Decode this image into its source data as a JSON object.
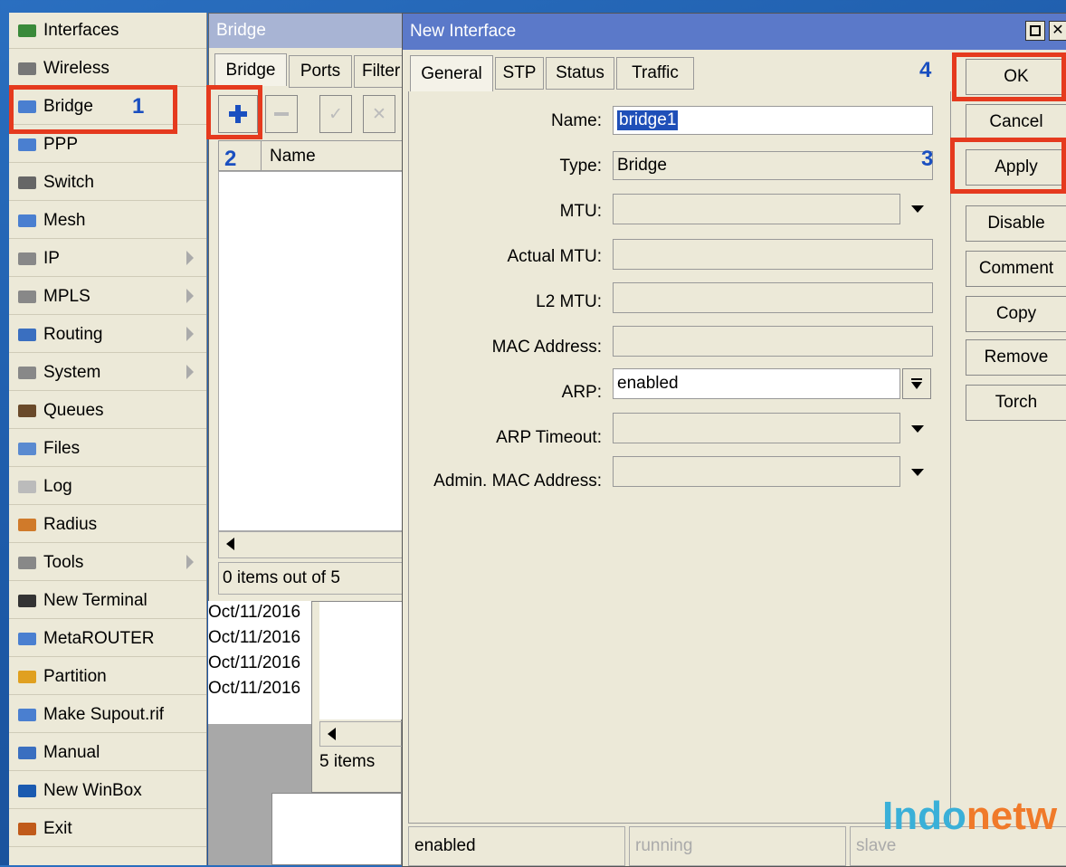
{
  "menu": {
    "items": [
      {
        "label": "Interfaces",
        "icon": "interfaces-icon",
        "sub": false
      },
      {
        "label": "Wireless",
        "icon": "wireless-icon",
        "sub": false
      },
      {
        "label": "Bridge",
        "icon": "bridge-icon",
        "sub": false
      },
      {
        "label": "PPP",
        "icon": "ppp-icon",
        "sub": false
      },
      {
        "label": "Switch",
        "icon": "switch-icon",
        "sub": false
      },
      {
        "label": "Mesh",
        "icon": "mesh-icon",
        "sub": false
      },
      {
        "label": "IP",
        "icon": "ip-icon",
        "sub": true
      },
      {
        "label": "MPLS",
        "icon": "mpls-icon",
        "sub": true
      },
      {
        "label": "Routing",
        "icon": "routing-icon",
        "sub": true
      },
      {
        "label": "System",
        "icon": "system-icon",
        "sub": true
      },
      {
        "label": "Queues",
        "icon": "queues-icon",
        "sub": false
      },
      {
        "label": "Files",
        "icon": "files-icon",
        "sub": false
      },
      {
        "label": "Log",
        "icon": "log-icon",
        "sub": false
      },
      {
        "label": "Radius",
        "icon": "radius-icon",
        "sub": false
      },
      {
        "label": "Tools",
        "icon": "tools-icon",
        "sub": true
      },
      {
        "label": "New Terminal",
        "icon": "terminal-icon",
        "sub": false
      },
      {
        "label": "MetaROUTER",
        "icon": "metarouter-icon",
        "sub": false
      },
      {
        "label": "Partition",
        "icon": "partition-icon",
        "sub": false
      },
      {
        "label": "Make Supout.rif",
        "icon": "supout-icon",
        "sub": false
      },
      {
        "label": "Manual",
        "icon": "manual-icon",
        "sub": false
      },
      {
        "label": "New WinBox",
        "icon": "winbox-icon",
        "sub": false
      },
      {
        "label": "Exit",
        "icon": "exit-icon",
        "sub": false
      }
    ]
  },
  "annotations": {
    "n1": "1",
    "n2": "2",
    "n3": "3",
    "n4": "4"
  },
  "bridge_window": {
    "title": "Bridge",
    "tabs": [
      "Bridge",
      "Ports",
      "Filter"
    ],
    "column_name": "Name",
    "status": "0 items out of 5",
    "dates": [
      "Oct/11/2016",
      "Oct/11/2016",
      "Oct/11/2016",
      "Oct/11/2016"
    ],
    "back_status": "5 items"
  },
  "dialog": {
    "title": "New Interface",
    "tabs": [
      "General",
      "STP",
      "Status",
      "Traffic"
    ],
    "fields": {
      "name_label": "Name:",
      "name_value": "bridge1",
      "type_label": "Type:",
      "type_value": "Bridge",
      "mtu_label": "MTU:",
      "actual_mtu_label": "Actual MTU:",
      "l2mtu_label": "L2 MTU:",
      "mac_label": "MAC Address:",
      "arp_label": "ARP:",
      "arp_value": "enabled",
      "arp_timeout_label": "ARP Timeout:",
      "admin_mac_label": "Admin. MAC Address:"
    },
    "buttons": {
      "ok": "OK",
      "cancel": "Cancel",
      "apply": "Apply",
      "disable": "Disable",
      "comment": "Comment",
      "copy": "Copy",
      "remove": "Remove",
      "torch": "Torch"
    },
    "statusbar": {
      "s1": "enabled",
      "s2": "running",
      "s3": "slave"
    }
  },
  "watermark": "Indonetw",
  "colors": {
    "highlight": "#e53a1e",
    "number": "#1a4fc0",
    "titlebar": "#5b79c9",
    "watermark_a": "#3ab0d8",
    "watermark_b": "#f07a2a"
  }
}
